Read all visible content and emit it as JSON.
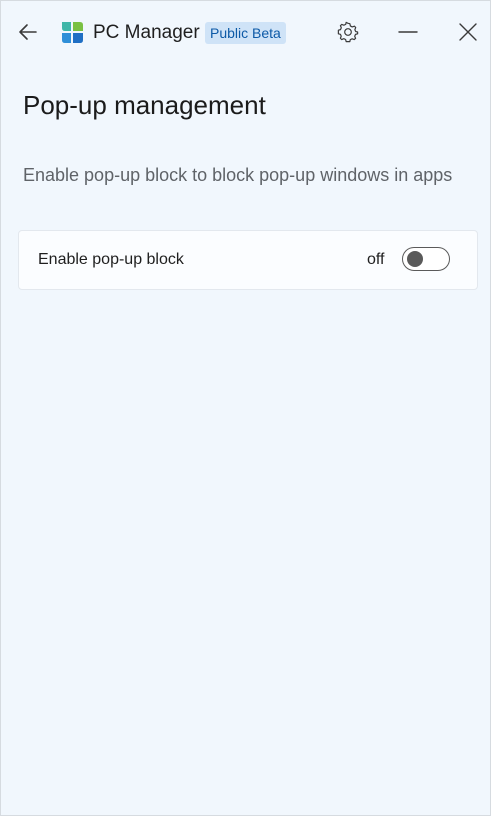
{
  "app": {
    "name": "PC Manager",
    "badge": "Public Beta"
  },
  "page": {
    "title": "Pop-up management",
    "description": "Enable pop-up block to block pop-up windows in apps"
  },
  "settings": {
    "popup_block": {
      "label": "Enable pop-up block",
      "state_text": "off",
      "enabled": false
    }
  },
  "icons": {
    "back": "arrow-left-icon",
    "logo": "pc-manager-logo",
    "settings": "gear-icon",
    "minimize": "minimize-icon",
    "close": "close-icon"
  },
  "colors": {
    "background": "#f1f7fd",
    "badge_background": "#cfe3f7",
    "badge_text": "#0d5aa7",
    "toggle_off": "#5a5a5a"
  }
}
